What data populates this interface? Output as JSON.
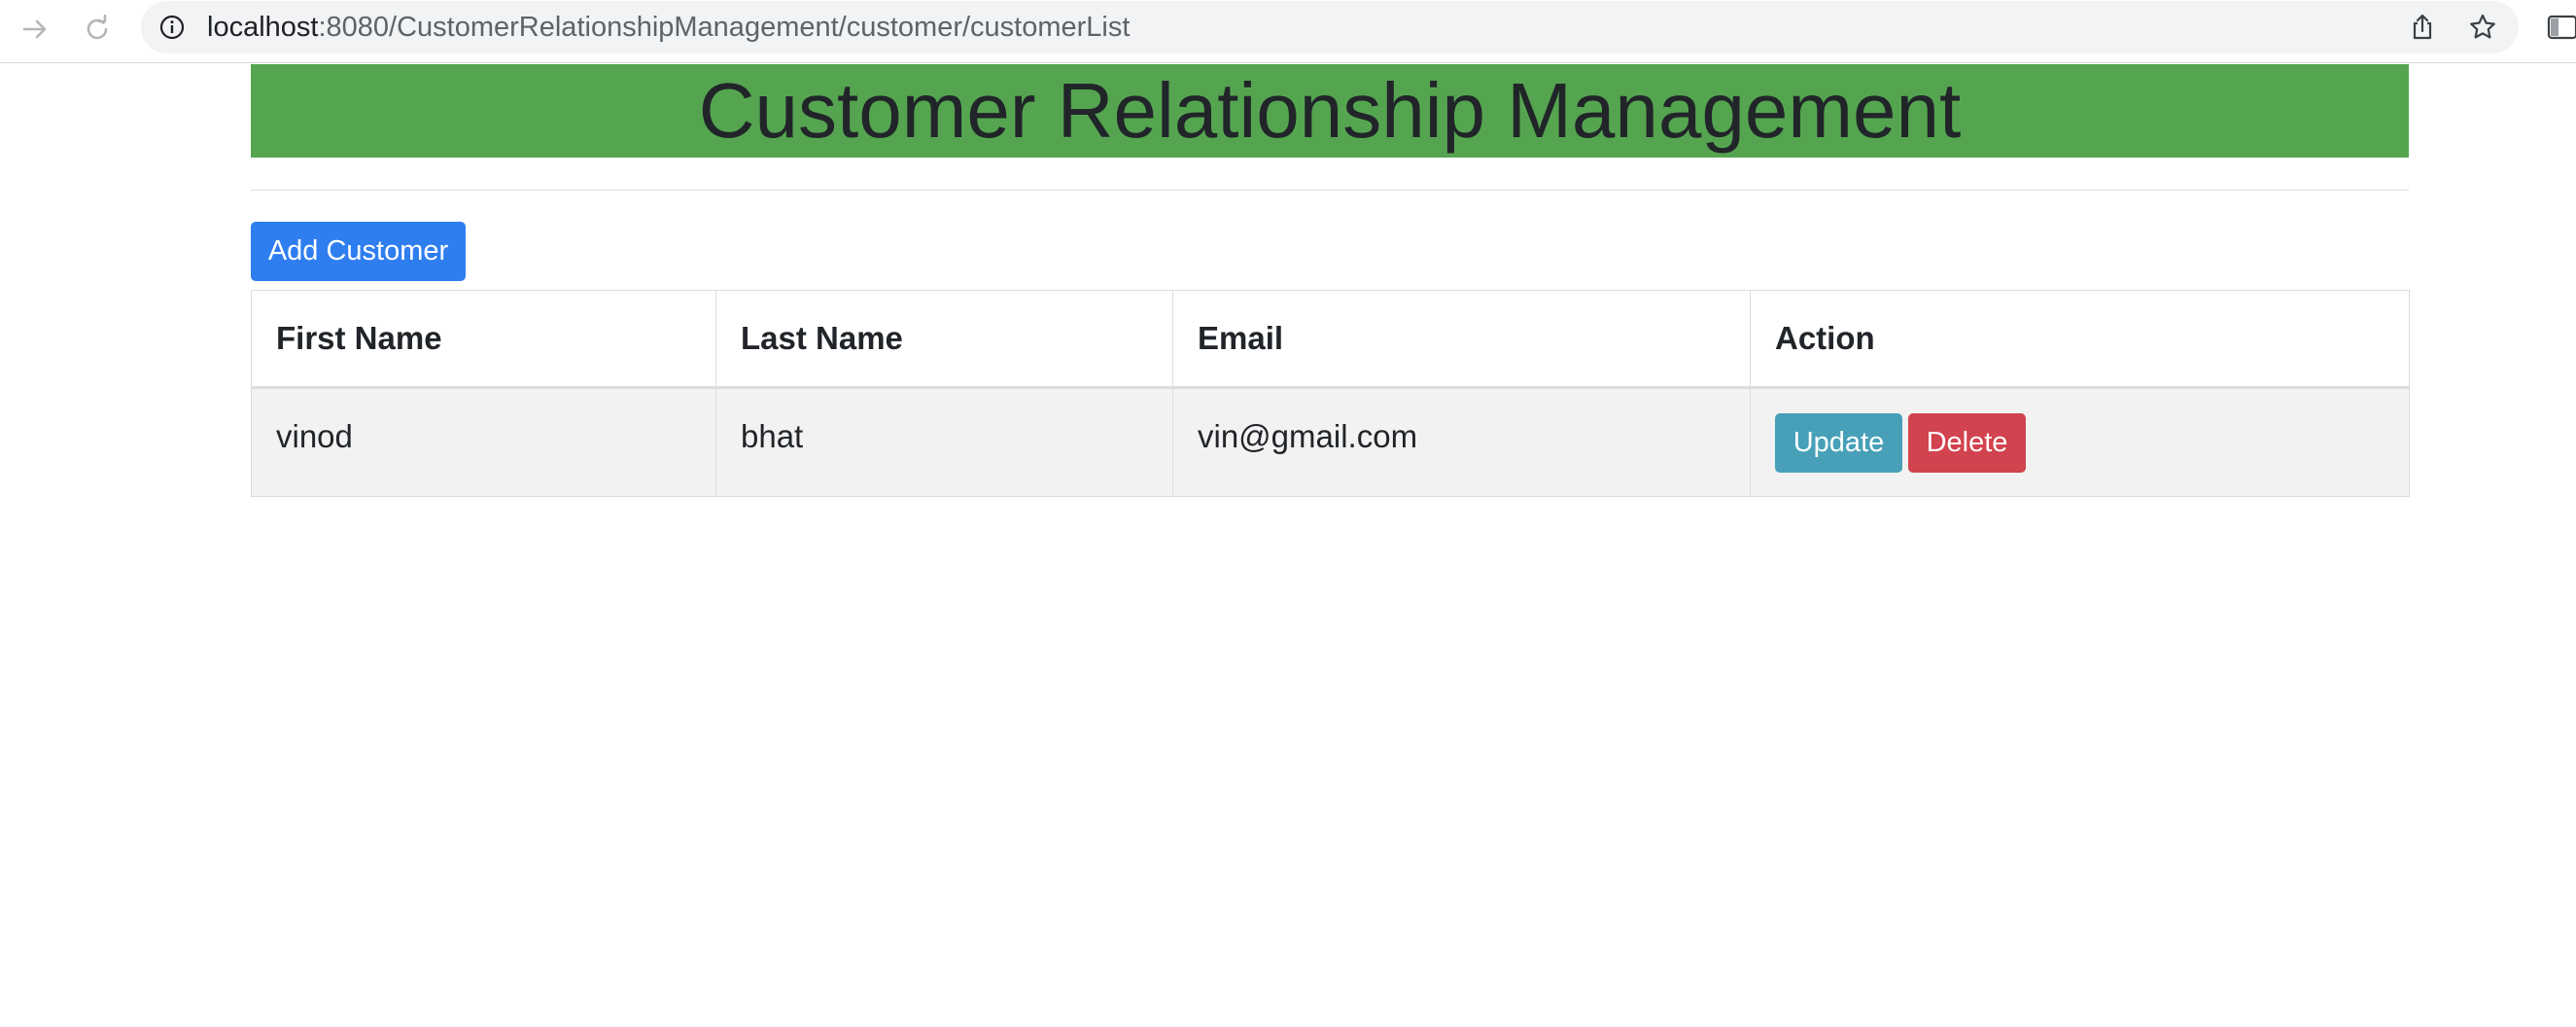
{
  "browser": {
    "url_host": "localhost",
    "url_path": ":8080/CustomerRelationshipManagement/customer/customerList"
  },
  "page": {
    "title": "Customer Relationship Management",
    "add_button_label": "Add Customer"
  },
  "table": {
    "headers": [
      "First Name",
      "Last Name",
      "Email",
      "Action"
    ],
    "rows": [
      {
        "first_name": "vinod",
        "last_name": "bhat",
        "email": "vin@gmail.com",
        "update_label": "Update",
        "delete_label": "Delete"
      }
    ]
  },
  "colors": {
    "banner": "#55a550",
    "primary": "#2f7ef0",
    "info": "#47a0b8",
    "danger": "#d1434e"
  },
  "icons": [
    "forward-icon",
    "reload-icon",
    "info-icon",
    "share-icon",
    "star-icon",
    "side-panel-icon"
  ]
}
